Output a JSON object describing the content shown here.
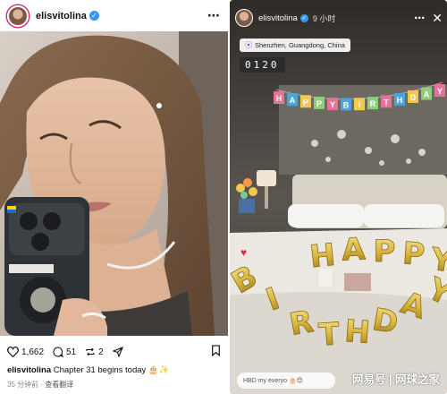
{
  "post": {
    "username": "elisvitolina",
    "verified_mark": "✓",
    "more_icon": "⋯",
    "likes": "1,662",
    "comments": "51",
    "reposts": "2",
    "caption_user": "elisvitolina",
    "caption_text": " Chapter 31 begins today 🎂✨",
    "time_ago": "35 分钟前",
    "translate": "查看翻译",
    "icons": [
      "heart-icon",
      "comment-icon",
      "repost-icon",
      "share-icon",
      "bookmark-icon"
    ]
  },
  "story": {
    "username": "elisvitolina",
    "verified_mark": "✓",
    "time_ago": "9 小时",
    "location": "Shenzhen, Guangdong, China",
    "clock": "0120",
    "reply_placeholder": "HBD my everyo 🎂😊",
    "banner_letters": [
      "H",
      "A",
      "P",
      "P",
      "Y",
      "B",
      "I",
      "R",
      "T",
      "H",
      "D",
      "A",
      "Y"
    ],
    "balloon_line1": "HAPPY",
    "balloon_line2": "BIRTHDAY"
  },
  "watermark": "网易号 | 网球之家",
  "colors": {
    "verified": "#3897f0",
    "balloon_gold": "#d9b53a",
    "location_pin": "#8a4fd6"
  }
}
